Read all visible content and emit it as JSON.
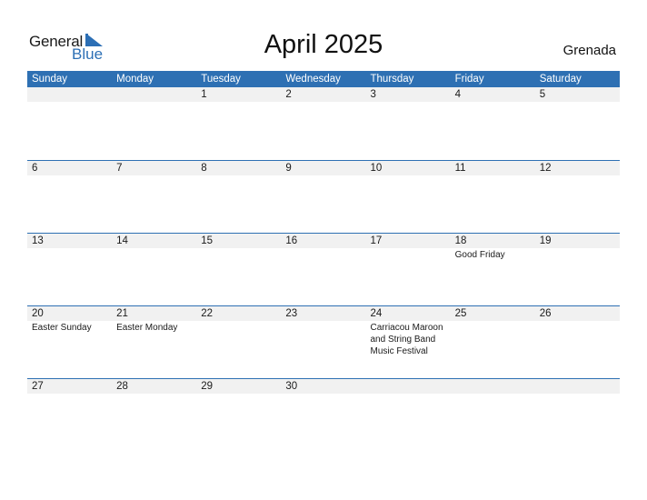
{
  "logo": {
    "line1": "General",
    "line2": "Blue"
  },
  "header": {
    "title": "April 2025",
    "country": "Grenada"
  },
  "colors": {
    "accent": "#2e70b3",
    "date_band": "#f1f1f1"
  },
  "weekdays": [
    "Sunday",
    "Monday",
    "Tuesday",
    "Wednesday",
    "Thursday",
    "Friday",
    "Saturday"
  ],
  "weeks": [
    [
      {
        "day": "",
        "event": ""
      },
      {
        "day": "",
        "event": ""
      },
      {
        "day": "1",
        "event": ""
      },
      {
        "day": "2",
        "event": ""
      },
      {
        "day": "3",
        "event": ""
      },
      {
        "day": "4",
        "event": ""
      },
      {
        "day": "5",
        "event": ""
      }
    ],
    [
      {
        "day": "6",
        "event": ""
      },
      {
        "day": "7",
        "event": ""
      },
      {
        "day": "8",
        "event": ""
      },
      {
        "day": "9",
        "event": ""
      },
      {
        "day": "10",
        "event": ""
      },
      {
        "day": "11",
        "event": ""
      },
      {
        "day": "12",
        "event": ""
      }
    ],
    [
      {
        "day": "13",
        "event": ""
      },
      {
        "day": "14",
        "event": ""
      },
      {
        "day": "15",
        "event": ""
      },
      {
        "day": "16",
        "event": ""
      },
      {
        "day": "17",
        "event": ""
      },
      {
        "day": "18",
        "event": "Good Friday"
      },
      {
        "day": "19",
        "event": ""
      }
    ],
    [
      {
        "day": "20",
        "event": "Easter Sunday"
      },
      {
        "day": "21",
        "event": "Easter Monday"
      },
      {
        "day": "22",
        "event": ""
      },
      {
        "day": "23",
        "event": ""
      },
      {
        "day": "24",
        "event": "Carriacou Maroon and String Band Music Festival"
      },
      {
        "day": "25",
        "event": ""
      },
      {
        "day": "26",
        "event": ""
      }
    ],
    [
      {
        "day": "27",
        "event": ""
      },
      {
        "day": "28",
        "event": ""
      },
      {
        "day": "29",
        "event": ""
      },
      {
        "day": "30",
        "event": ""
      },
      {
        "day": "",
        "event": ""
      },
      {
        "day": "",
        "event": ""
      },
      {
        "day": "",
        "event": ""
      }
    ]
  ]
}
